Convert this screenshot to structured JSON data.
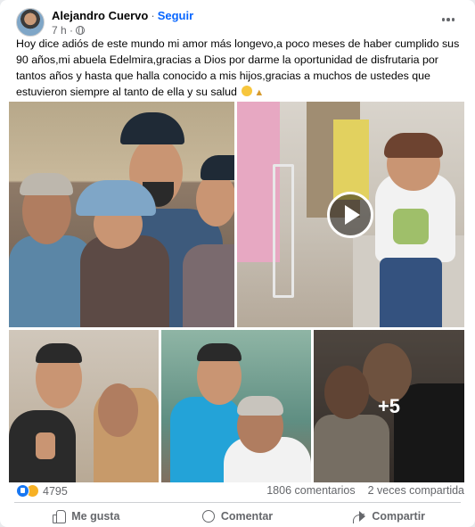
{
  "post": {
    "author": "Alejandro Cuervo",
    "separator": "·",
    "follow_label": "Seguir",
    "time": "7 h ·",
    "text": "Hoy dice adiós de este mundo mi amor más longevo,a poco meses de haber cumplido sus 90 años,mi abuela Edelmira,gracias a Dios por darme la oportunidad de disfrutaria por tantos años y hasta que halla conocido a mis hijos,gracias a muchos de ustedes que estuvieron siempre al tanto de ella y su salud",
    "text_emoji": [
      "sad-face-emoji",
      "praying-hands-emoji"
    ],
    "more_photos_label": "+5"
  },
  "stats": {
    "reaction_count": "4795",
    "comments": "1806 comentarios",
    "shares": "2 veces compartida"
  },
  "actions": {
    "like": "Me gusta",
    "comment": "Comentar",
    "share": "Compartir"
  },
  "colors": {
    "accent": "#0866ff",
    "muted": "#65676b",
    "like_blue": "#1877f2",
    "care_yellow": "#f7b125"
  }
}
